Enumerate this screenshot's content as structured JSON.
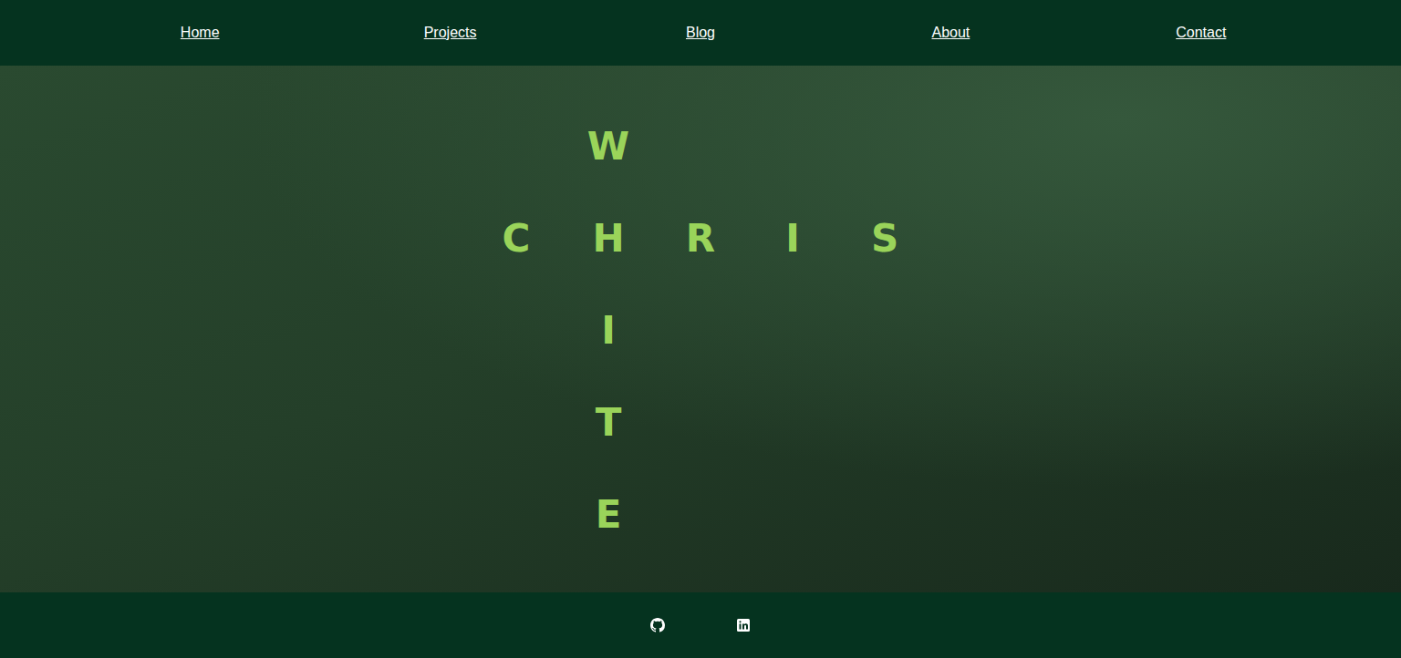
{
  "nav": {
    "links": [
      {
        "label": "Home"
      },
      {
        "label": "Projects"
      },
      {
        "label": "Blog"
      },
      {
        "label": "About"
      },
      {
        "label": "Contact"
      }
    ]
  },
  "hero": {
    "across": "CHRIS",
    "down": "WHITE"
  },
  "footer": {
    "links": [
      {
        "kind": "github"
      },
      {
        "kind": "linkedin"
      }
    ]
  }
}
